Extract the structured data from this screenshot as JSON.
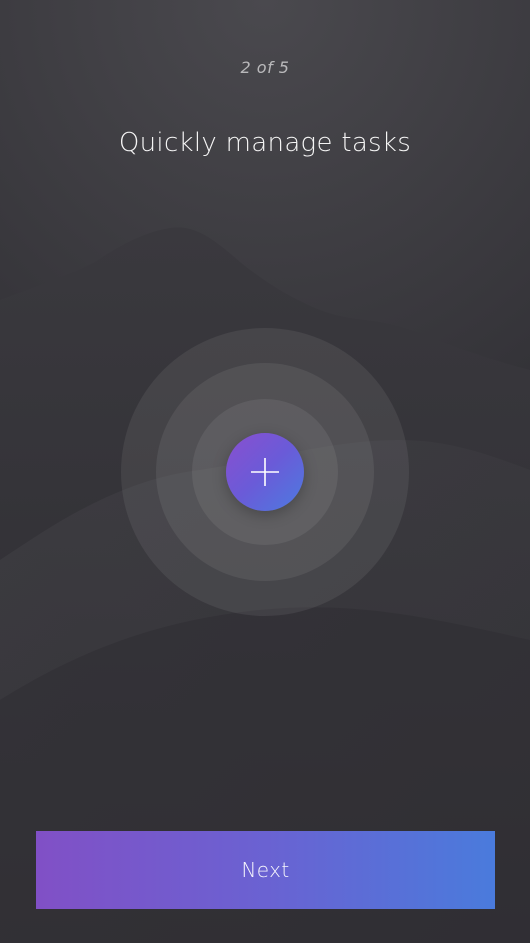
{
  "onboarding": {
    "step_indicator": "2 of 5",
    "title": "Quickly manage tasks",
    "add_icon": "plus-icon",
    "next_label": "Next"
  },
  "colors": {
    "background": "#36353a",
    "gradient_start": "#8150c6",
    "gradient_end": "#4a7bdc",
    "text": "#ffffff"
  }
}
